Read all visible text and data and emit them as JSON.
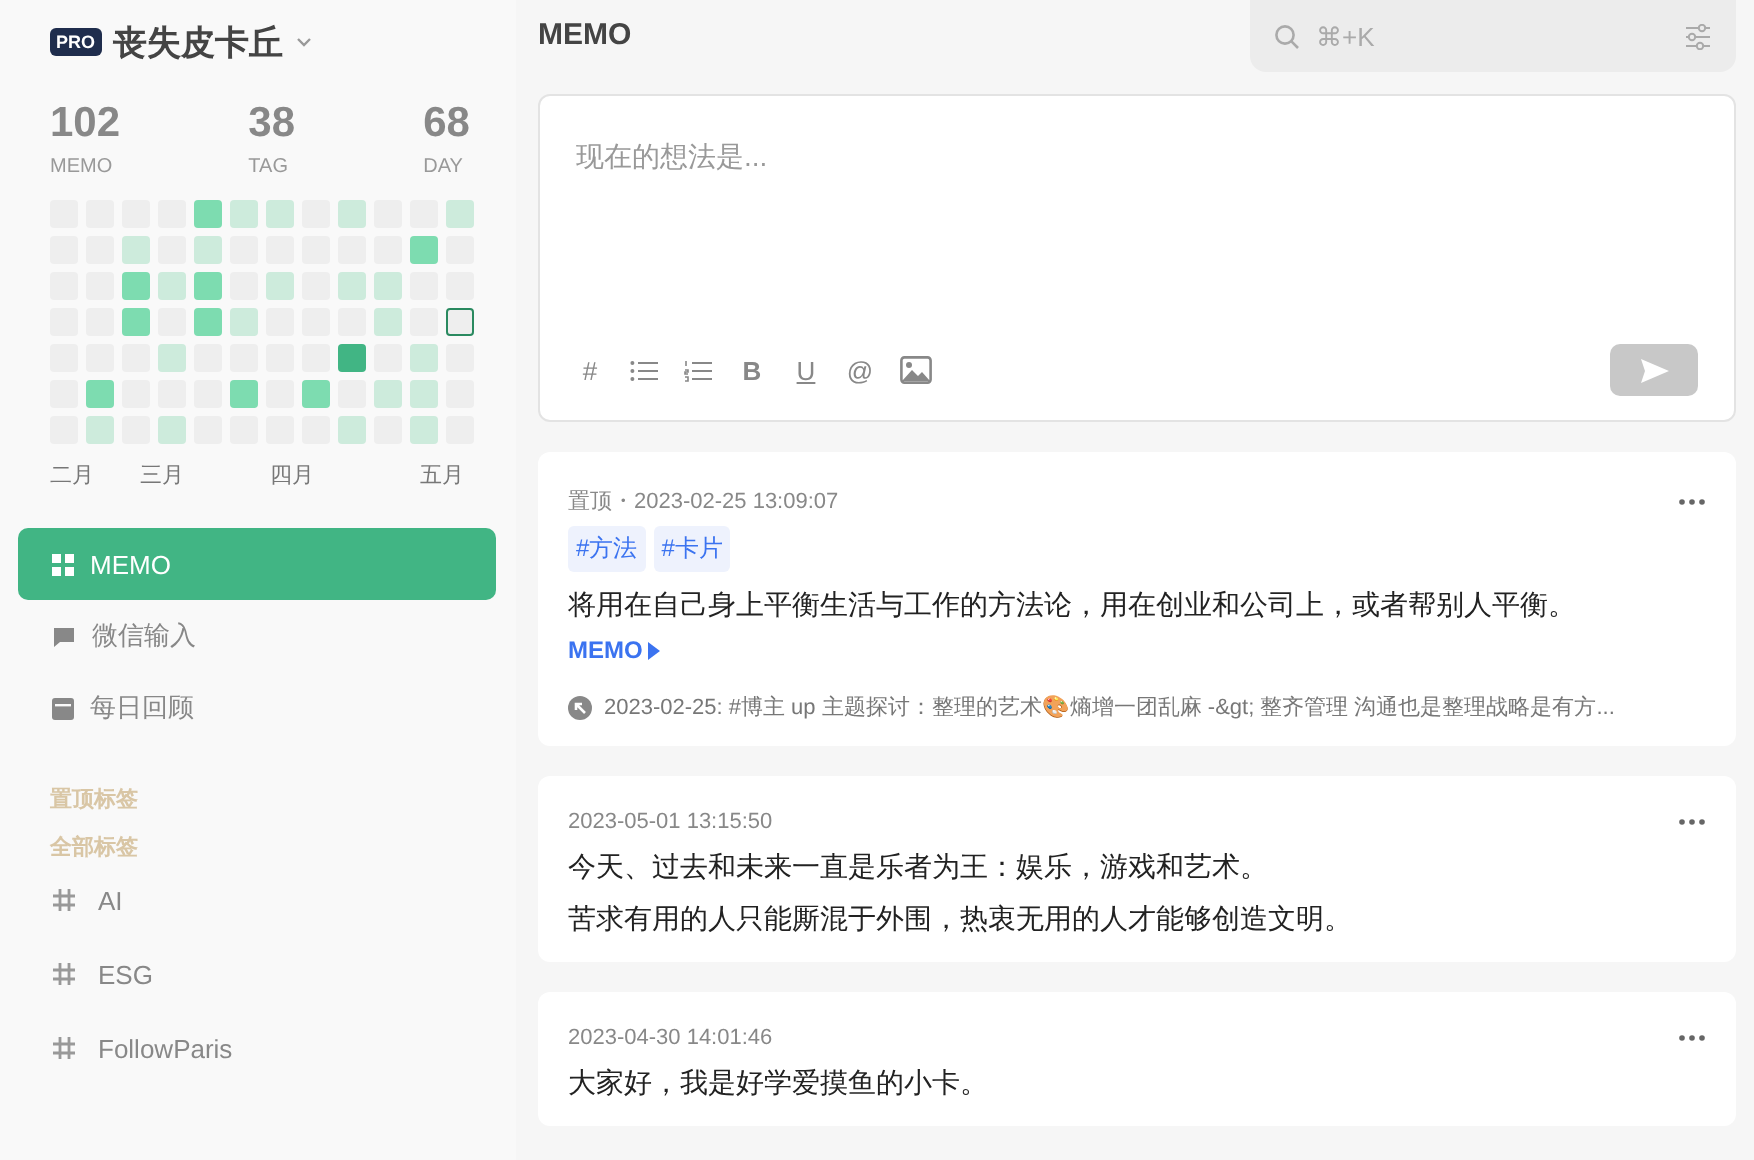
{
  "sidebar": {
    "badge": "PRO",
    "username": "丧失皮卡丘",
    "stats": [
      {
        "value": "102",
        "label": "MEMO"
      },
      {
        "value": "38",
        "label": "TAG"
      },
      {
        "value": "68",
        "label": "DAY"
      }
    ],
    "heatmap": {
      "rows": [
        [
          {
            "color": "#eeeeee",
            "today": false
          },
          {
            "color": "#eeeeee",
            "today": false
          },
          {
            "color": "#eeeeee",
            "today": false
          },
          {
            "color": "#eeeeee",
            "today": false
          },
          {
            "color": "#7ddcb0",
            "today": false
          },
          {
            "color": "#cdebdc",
            "today": false
          },
          {
            "color": "#cdebdc",
            "today": false
          },
          {
            "color": "#eeeeee",
            "today": false
          },
          {
            "color": "#cdebdc",
            "today": false
          },
          {
            "color": "#eeeeee",
            "today": false
          },
          {
            "color": "#eeeeee",
            "today": false
          },
          {
            "color": "#cdebdc",
            "today": false
          }
        ],
        [
          {
            "color": "#eeeeee",
            "today": false
          },
          {
            "color": "#eeeeee",
            "today": false
          },
          {
            "color": "#cdebdc",
            "today": false
          },
          {
            "color": "#eeeeee",
            "today": false
          },
          {
            "color": "#cdebdc",
            "today": false
          },
          {
            "color": "#eeeeee",
            "today": false
          },
          {
            "color": "#eeeeee",
            "today": false
          },
          {
            "color": "#eeeeee",
            "today": false
          },
          {
            "color": "#eeeeee",
            "today": false
          },
          {
            "color": "#eeeeee",
            "today": false
          },
          {
            "color": "#7ddcb0",
            "today": false
          },
          {
            "color": "#eeeeee",
            "today": false
          }
        ],
        [
          {
            "color": "#eeeeee",
            "today": false
          },
          {
            "color": "#eeeeee",
            "today": false
          },
          {
            "color": "#7ddcb0",
            "today": false
          },
          {
            "color": "#cdebdc",
            "today": false
          },
          {
            "color": "#7ddcb0",
            "today": false
          },
          {
            "color": "#eeeeee",
            "today": false
          },
          {
            "color": "#cdebdc",
            "today": false
          },
          {
            "color": "#eeeeee",
            "today": false
          },
          {
            "color": "#cdebdc",
            "today": false
          },
          {
            "color": "#cdebdc",
            "today": false
          },
          {
            "color": "#eeeeee",
            "today": false
          },
          {
            "color": "#eeeeee",
            "today": false
          }
        ],
        [
          {
            "color": "#eeeeee",
            "today": false
          },
          {
            "color": "#eeeeee",
            "today": false
          },
          {
            "color": "#7ddcb0",
            "today": false
          },
          {
            "color": "#eeeeee",
            "today": false
          },
          {
            "color": "#7ddcb0",
            "today": false
          },
          {
            "color": "#cdebdc",
            "today": false
          },
          {
            "color": "#eeeeee",
            "today": false
          },
          {
            "color": "#eeeeee",
            "today": false
          },
          {
            "color": "#eeeeee",
            "today": false
          },
          {
            "color": "#cdebdc",
            "today": false
          },
          {
            "color": "#eeeeee",
            "today": false
          },
          {
            "color": "#eeeeee",
            "today": true
          }
        ],
        [
          {
            "color": "#eeeeee",
            "today": false
          },
          {
            "color": "#eeeeee",
            "today": false
          },
          {
            "color": "#eeeeee",
            "today": false
          },
          {
            "color": "#cdebdc",
            "today": false
          },
          {
            "color": "#eeeeee",
            "today": false
          },
          {
            "color": "#eeeeee",
            "today": false
          },
          {
            "color": "#eeeeee",
            "today": false
          },
          {
            "color": "#eeeeee",
            "today": false
          },
          {
            "color": "#41b584",
            "today": false
          },
          {
            "color": "#eeeeee",
            "today": false
          },
          {
            "color": "#cdebdc",
            "today": false
          },
          {
            "color": "#eeeeee",
            "today": false
          }
        ],
        [
          {
            "color": "#eeeeee",
            "today": false
          },
          {
            "color": "#7ddcb0",
            "today": false
          },
          {
            "color": "#eeeeee",
            "today": false
          },
          {
            "color": "#eeeeee",
            "today": false
          },
          {
            "color": "#eeeeee",
            "today": false
          },
          {
            "color": "#7ddcb0",
            "today": false
          },
          {
            "color": "#eeeeee",
            "today": false
          },
          {
            "color": "#7ddcb0",
            "today": false
          },
          {
            "color": "#eeeeee",
            "today": false
          },
          {
            "color": "#cdebdc",
            "today": false
          },
          {
            "color": "#cdebdc",
            "today": false
          },
          {
            "color": "#eeeeee",
            "today": false
          }
        ],
        [
          {
            "color": "#eeeeee",
            "today": false
          },
          {
            "color": "#cdebdc",
            "today": false
          },
          {
            "color": "#eeeeee",
            "today": false
          },
          {
            "color": "#cdebdc",
            "today": false
          },
          {
            "color": "#eeeeee",
            "today": false
          },
          {
            "color": "#eeeeee",
            "today": false
          },
          {
            "color": "#eeeeee",
            "today": false
          },
          {
            "color": "#eeeeee",
            "today": false
          },
          {
            "color": "#cdebdc",
            "today": false
          },
          {
            "color": "#eeeeee",
            "today": false
          },
          {
            "color": "#cdebdc",
            "today": false
          },
          {
            "color": "#eeeeee",
            "today": false
          }
        ]
      ],
      "months": [
        "二月",
        "三月",
        "四月",
        "五月"
      ]
    },
    "nav": [
      {
        "kind": "grid",
        "label": "MEMO",
        "selected": true
      },
      {
        "kind": "chat",
        "label": "微信输入",
        "selected": false
      },
      {
        "kind": "calendar",
        "label": "每日回顾",
        "selected": false
      }
    ],
    "sections": [
      "置顶标签",
      "全部标签"
    ],
    "tags": [
      {
        "label": "AI"
      },
      {
        "label": "ESG"
      },
      {
        "label": "FollowParis"
      }
    ]
  },
  "header": {
    "title": "MEMO",
    "search": {
      "placeholder": "⌘+K"
    }
  },
  "editor": {
    "placeholder": "现在的想法是...",
    "toolbar": [
      {
        "kind": "text",
        "label": "#"
      },
      {
        "kind": "bullet"
      },
      {
        "kind": "numbered"
      },
      {
        "kind": "text",
        "label": "B"
      },
      {
        "kind": "text",
        "label": "U"
      },
      {
        "kind": "text",
        "label": "@"
      },
      {
        "kind": "image"
      }
    ],
    "send_disabled": true
  },
  "memos": [
    {
      "time": "置顶・2023-02-25 13:09:07",
      "tags": [
        "#方法",
        "#卡片"
      ],
      "lines": [
        "将用在自己身上平衡生活与工作的方法论，用在创业和公司上，或者帮别人平衡。"
      ],
      "link": "MEMO",
      "reference": "2023-02-25: #博主 up 主题探讨：整理的艺术🎨熵增一团乱麻 -&gt; 整齐管理 沟通也是整理战略是有方..."
    },
    {
      "time": "2023-05-01 13:15:50",
      "lines": [
        "今天、过去和未来一直是乐者为王：娱乐，游戏和艺术。",
        "苦求有用的人只能厮混于外围，热衷无用的人才能够创造文明。"
      ]
    },
    {
      "time": "2023-04-30 14:01:46",
      "lines": [
        "大家好，我是好学爱摸鱼的小卡。"
      ]
    }
  ]
}
